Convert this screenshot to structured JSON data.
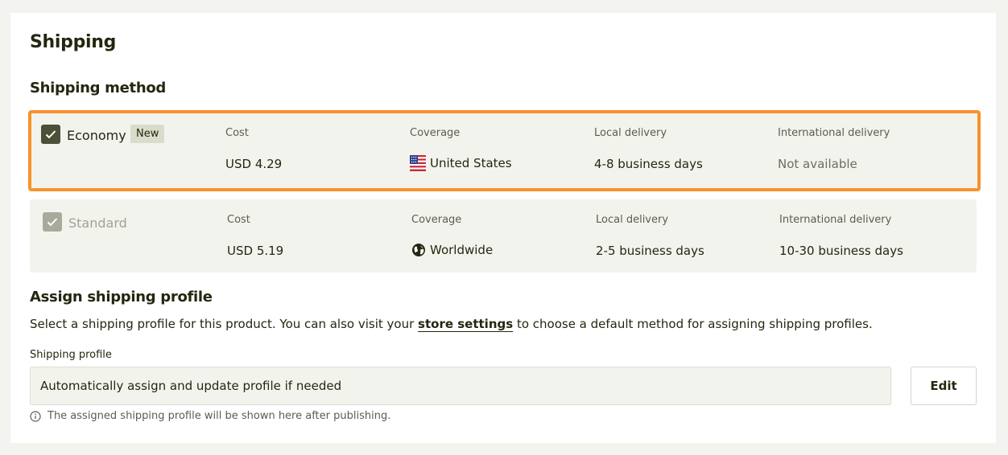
{
  "page": {
    "title": "Shipping"
  },
  "shipping_method": {
    "heading": "Shipping method",
    "columns": {
      "cost": "Cost",
      "coverage": "Coverage",
      "local": "Local delivery",
      "international": "International delivery"
    },
    "methods": [
      {
        "name": "Economy",
        "badge": "New",
        "checked": true,
        "disabled": false,
        "cost": "USD 4.29",
        "coverage": "United States",
        "coverage_icon": "us-flag-icon",
        "local": "4-8 business days",
        "international": "Not available"
      },
      {
        "name": "Standard",
        "checked": true,
        "disabled": true,
        "cost": "USD 5.19",
        "coverage": "Worldwide",
        "coverage_icon": "globe-icon",
        "local": "2-5 business days",
        "international": "10-30 business days"
      }
    ]
  },
  "assign_profile": {
    "heading": "Assign shipping profile",
    "desc_before": "Select a shipping profile for this product. You can also visit your ",
    "desc_link": "store settings",
    "desc_after": " to choose a default method for assigning shipping profiles.",
    "field_label": "Shipping profile",
    "field_value": "Automatically assign and update profile if needed",
    "edit_label": "Edit",
    "hint": "The assigned shipping profile will be shown here after publishing.",
    "hint_icon": "info-icon"
  },
  "colors": {
    "highlight": "#f7922c",
    "checkbox_active": "#4b5036",
    "checkbox_disabled": "#a8ab9c"
  }
}
